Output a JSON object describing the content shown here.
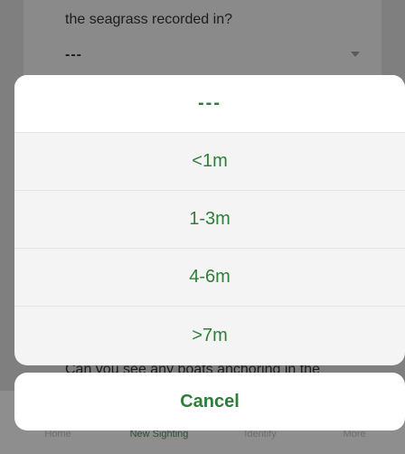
{
  "background": {
    "question": "the seagrass recorded in?",
    "select_value": "---",
    "question2": "Can you see any boats anchoring in the",
    "tabs": [
      {
        "label": "Home"
      },
      {
        "label": "New Sighting"
      },
      {
        "label": "Identify"
      },
      {
        "label": "More"
      }
    ]
  },
  "sheet": {
    "options": [
      {
        "label": "---"
      },
      {
        "label": "<1m"
      },
      {
        "label": "1-3m"
      },
      {
        "label": "4-6m"
      },
      {
        "label": ">7m"
      }
    ],
    "cancel_label": "Cancel"
  },
  "colors": {
    "accent": "#2f7d3a",
    "overlay": "#7f7f7f",
    "sheet_bg": "#f4f4f4"
  }
}
